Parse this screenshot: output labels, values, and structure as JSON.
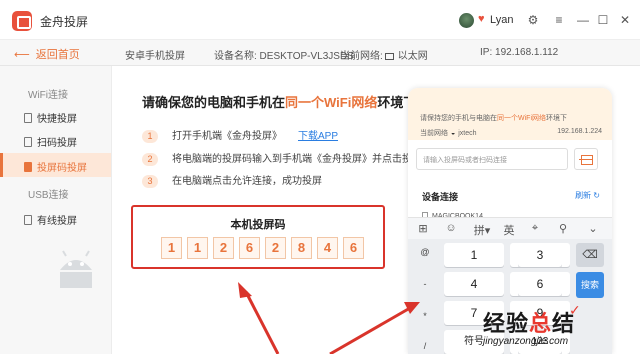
{
  "window": {
    "title": "金舟投屏",
    "user_name": "Lyan",
    "controls": [
      "⚙",
      "≡",
      "—",
      "☐",
      "✕"
    ]
  },
  "infobar": {
    "back_label": "返回首页",
    "mode": "安卓手机投屏",
    "device_label": "设备名称: DESKTOP-VL3JSDS",
    "network_label": "当前网络:",
    "network_value": "以太网",
    "ip_label": "IP: 192.168.1.112"
  },
  "sidebar": {
    "group_wifi": "WiFi连接",
    "items_wifi": [
      "快捷投屏",
      "扫码投屏",
      "投屏码投屏"
    ],
    "active_item": "投屏码投屏",
    "group_usb": "USB连接",
    "items_usb": [
      "有线投屏"
    ]
  },
  "main": {
    "title_prefix": "请确保您的电脑和手机在",
    "title_highlight": "同一个WiFi网络",
    "title_suffix": "环境下",
    "steps": [
      {
        "num": "1",
        "text": "打开手机端《金舟投屏》",
        "link": "下载APP"
      },
      {
        "num": "2",
        "text": "将电脑端的投屏码输入到手机端《金舟投屏》并点击投屏"
      },
      {
        "num": "3",
        "text": "在电脑端点击允许连接，成功投屏"
      }
    ],
    "code_title": "本机投屏码",
    "code_digits": [
      "1",
      "1",
      "2",
      "6",
      "2",
      "8",
      "4",
      "6"
    ]
  },
  "phone": {
    "tip_prefix": "请保持您的手机与电脑在",
    "tip_highlight": "同一个WiFi网络",
    "tip_suffix": "环境下",
    "network_label": "当前网络",
    "network_name": "jxtech",
    "ip": "192.168.1.224",
    "input_placeholder": "请输入投屏码或者扫码连接",
    "devices_title": "设备连接",
    "refresh_label": "刷新",
    "device_item": "MAGICBOOK14",
    "keyboard": {
      "toolbar": [
        "⊞",
        "☺",
        "拼▾",
        "英",
        "⌖",
        "⚲",
        "⌄"
      ],
      "side_keys": [
        "@",
        "-",
        "*",
        "/"
      ],
      "keys": [
        [
          "1",
          "2",
          "3"
        ],
        [
          "4",
          "5",
          "6"
        ],
        [
          "7",
          "8",
          "9"
        ],
        [
          "符号",
          "0",
          "123"
        ]
      ],
      "backspace": "⌫",
      "search": "搜索"
    }
  },
  "watermark": {
    "text_a": "经验",
    "text_b": "总",
    "text_c": "结",
    "url": "jingyanzongjie.com"
  },
  "colors": {
    "accent": "#e8743c",
    "highlight_box": "#d9342b",
    "link": "#2a7de1"
  }
}
